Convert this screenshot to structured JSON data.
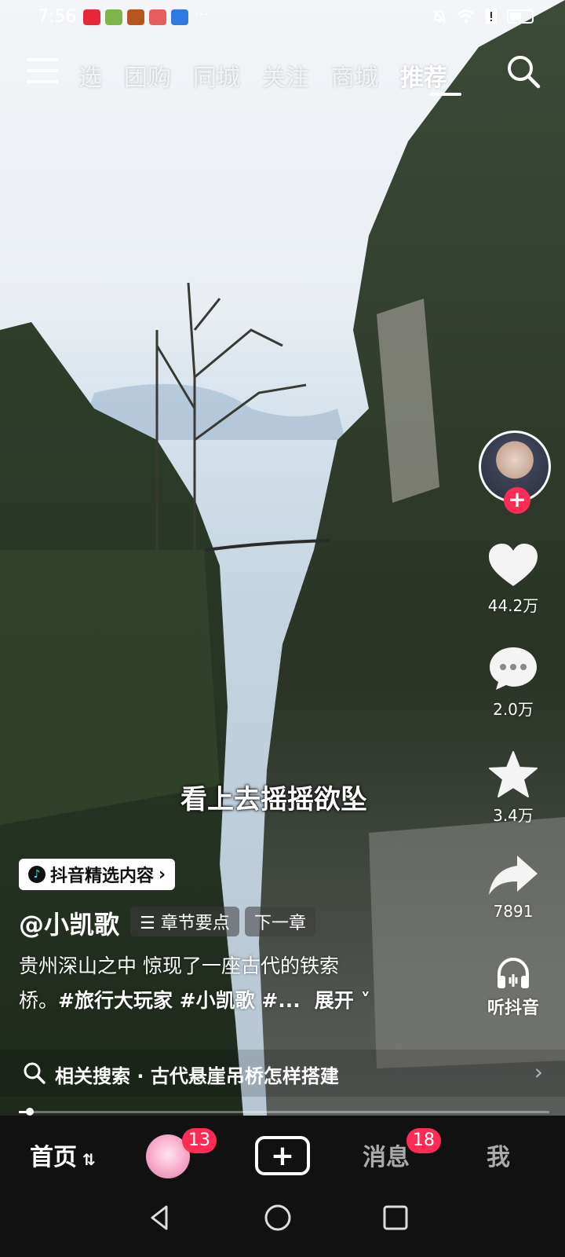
{
  "status_bar": {
    "time": "7:56",
    "more": "···"
  },
  "top_nav": {
    "tabs": [
      "选",
      "团购",
      "同城",
      "关注",
      "商城",
      "推荐"
    ],
    "active_tab": "推荐"
  },
  "video": {
    "subtitle": "看上去摇摇欲坠",
    "content_badge": "抖音精选内容",
    "author": "@小凯歌",
    "chapter_chip": "☰ 章节要点",
    "next_chip": "下一章",
    "description_line1": "贵州深山之中 惊现了一座古代的铁索",
    "description_line2_prefix": "桥。",
    "hashtags": "#旅行大玩家 #小凯歌 #...",
    "expand": "展开"
  },
  "side_actions": {
    "likes": "44.2万",
    "comments": "2.0万",
    "favorites": "3.4万",
    "shares": "7891",
    "listen": "听抖音"
  },
  "related_search": {
    "label": "相关搜索 · 古代悬崖吊桥怎样搭建"
  },
  "progress": {
    "fraction": 0.02
  },
  "bottom_nav": {
    "home": "首页",
    "friends_badge": "13",
    "messages": "消息",
    "messages_badge": "18",
    "me": "我"
  }
}
